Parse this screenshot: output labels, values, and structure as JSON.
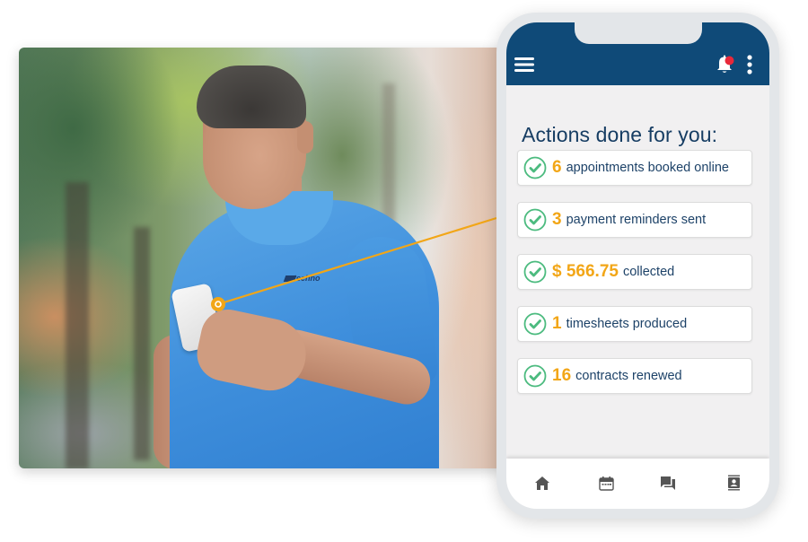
{
  "photo": {
    "description": "man in blue polo shirt looking at smartphone",
    "shirt_logo": "techno"
  },
  "colors": {
    "header": "#0f4a78",
    "accent_number": "#f2a617",
    "check_green": "#4cbb7f",
    "text_primary": "#1d4268",
    "notification_dot": "#e8283a",
    "connector_line": "#f2a617"
  },
  "phone": {
    "header": {
      "menu_icon": "hamburger-menu-icon",
      "notification_icon": "bell-icon",
      "more_icon": "vertical-ellipsis-icon",
      "has_unread_notification": true
    },
    "heading": "Actions done for you:",
    "actions": [
      {
        "icon": "check-circle-icon",
        "value": "6",
        "label": "appointments booked online"
      },
      {
        "icon": "check-circle-icon",
        "value": "3",
        "label": "payment reminders sent"
      },
      {
        "icon": "check-circle-icon",
        "value": "$ 566.75",
        "label": "collected"
      },
      {
        "icon": "check-circle-icon",
        "value": "1",
        "label": "timesheets produced"
      },
      {
        "icon": "check-circle-icon",
        "value": "16",
        "label": "contracts renewed"
      }
    ],
    "tabbar": [
      {
        "icon": "home-icon",
        "name": "home"
      },
      {
        "icon": "calendar-icon",
        "name": "calendar"
      },
      {
        "icon": "chat-icon",
        "name": "messages"
      },
      {
        "icon": "contacts-icon",
        "name": "contacts"
      }
    ]
  }
}
